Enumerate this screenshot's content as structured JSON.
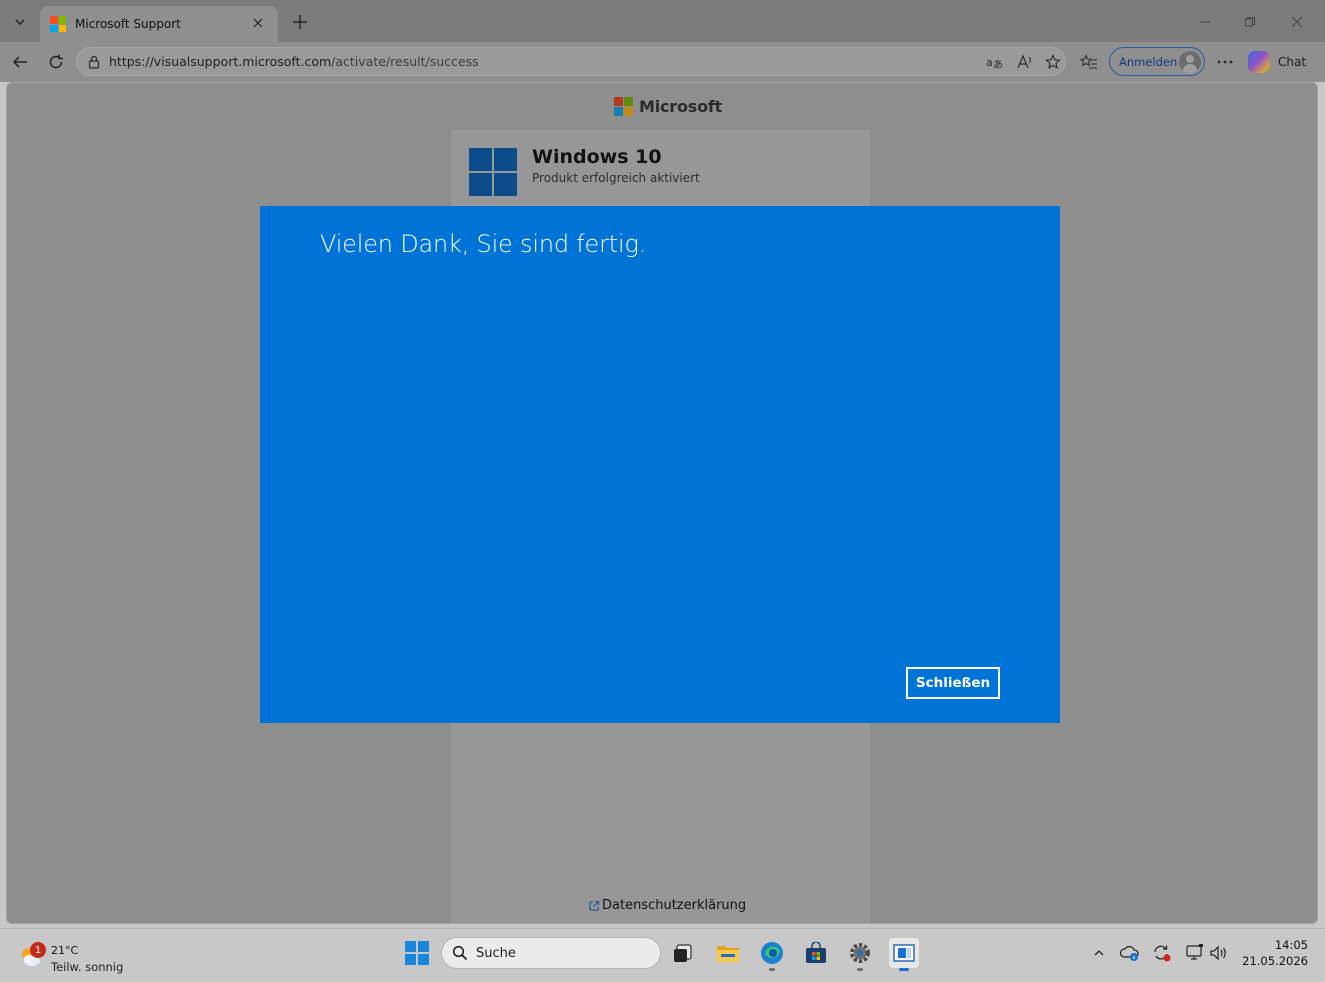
{
  "browser": {
    "tab": {
      "title": "Microsoft Support",
      "favicon": "microsoft-logo-icon"
    },
    "url": {
      "host": "https://visualsupport.microsoft.com",
      "path": "/activate/result/success"
    },
    "signin_label": "Anmelden",
    "chat_label": "Chat"
  },
  "page": {
    "brand": "Microsoft",
    "product_title": "Windows 10",
    "product_status": "Produkt erfolgreich aktiviert",
    "privacy_link": "Datenschutzerklärung"
  },
  "dialog": {
    "title": "Vielen Dank, Sie sind fertig.",
    "close_label": "Schließen",
    "background": "#0074d6"
  },
  "taskbar": {
    "weather": {
      "temperature": "21°C",
      "condition": "Teilw. sonnig",
      "badge": "1"
    },
    "search_placeholder": "Suche",
    "clock": {
      "time": "14:05",
      "date": "21.05.2026"
    }
  },
  "colors": {
    "ms_red": "#f25022",
    "ms_green": "#7fba00",
    "ms_blue": "#00a4ef",
    "ms_yellow": "#ffb900"
  }
}
